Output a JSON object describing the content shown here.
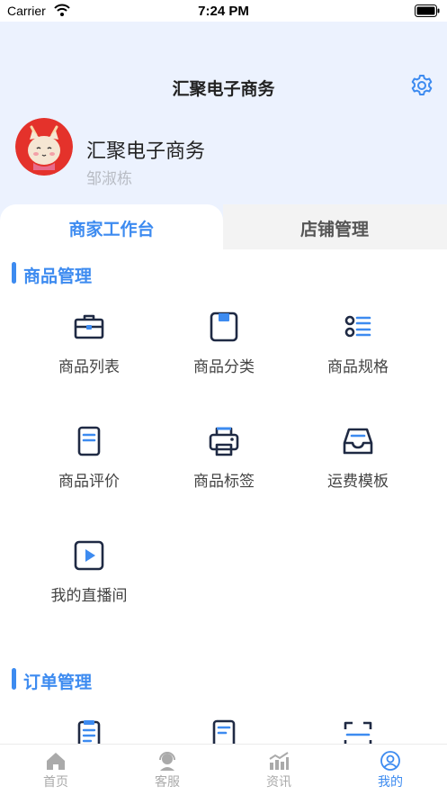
{
  "status_bar": {
    "carrier": "Carrier",
    "time": "7:24 PM"
  },
  "header": {
    "title": "汇聚电子商务",
    "shop_name": "汇聚电子商务",
    "user_name": "邹淑栋"
  },
  "tabs": [
    {
      "label": "商家工作台",
      "active": true
    },
    {
      "label": "店铺管理",
      "active": false
    }
  ],
  "sections": [
    {
      "title": "商品管理",
      "items": [
        {
          "label": "商品列表",
          "icon": "briefcase-icon"
        },
        {
          "label": "商品分类",
          "icon": "save-box-icon"
        },
        {
          "label": "商品规格",
          "icon": "spec-list-icon"
        },
        {
          "label": "商品评价",
          "icon": "document-icon"
        },
        {
          "label": "商品标签",
          "icon": "printer-icon"
        },
        {
          "label": "运费模板",
          "icon": "inbox-tray-icon"
        },
        {
          "label": "我的直播间",
          "icon": "play-video-icon"
        }
      ]
    },
    {
      "title": "订单管理",
      "items": [
        {
          "label": "",
          "icon": "order-list-icon"
        },
        {
          "label": "",
          "icon": "order-doc-icon"
        },
        {
          "label": "",
          "icon": "scan-icon"
        }
      ]
    }
  ],
  "tabbar": [
    {
      "label": "首页",
      "icon": "home-icon",
      "active": false
    },
    {
      "label": "客服",
      "icon": "service-headset-icon",
      "active": false
    },
    {
      "label": "资讯",
      "icon": "news-chart-icon",
      "active": false
    },
    {
      "label": "我的",
      "icon": "profile-icon",
      "active": true
    }
  ],
  "colors": {
    "accent": "#3d8bf0",
    "icon_dark": "#1f2a44",
    "header_bg": "#ecf2fe",
    "inactive": "#aaaaaa"
  }
}
